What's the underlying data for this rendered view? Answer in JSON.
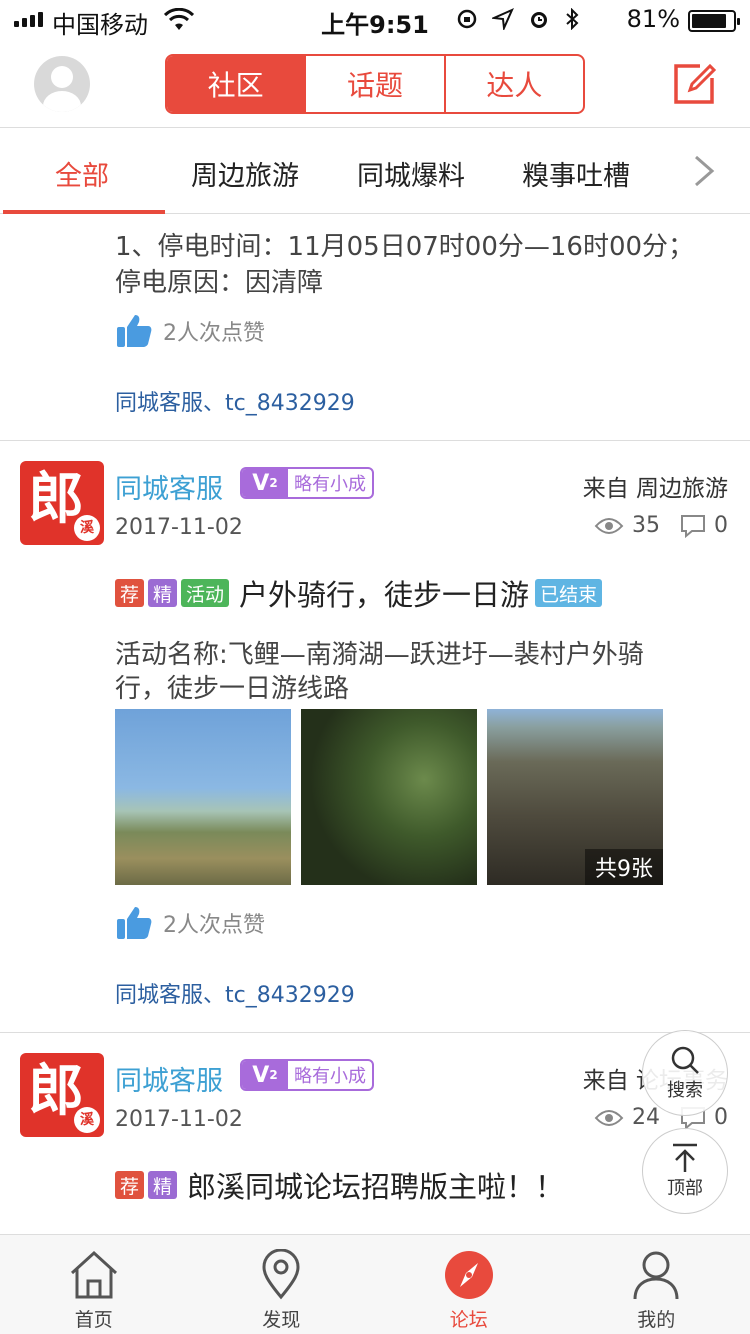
{
  "status_bar": {
    "carrier": "中国移动",
    "time": "上午9:51",
    "battery": "81%"
  },
  "header": {
    "segments": [
      "社区",
      "话题",
      "达人"
    ]
  },
  "categories": [
    "全部",
    "周边旅游",
    "同城爆料",
    "糗事吐槽"
  ],
  "partial_post": {
    "text_line1": "1、停电时间：11月05日07时00分—16时00分；",
    "text_line2": "停电原因：因清障",
    "likes": "2人次点赞",
    "likers": "同城客服、tc_8432929"
  },
  "posts": [
    {
      "avatar_char": "郎",
      "avatar_small": "溪",
      "author": "同城客服",
      "level_badge": "V",
      "level_num": "2",
      "level_title": "略有小成",
      "from": "来自 周边旅游",
      "date": "2017-11-02",
      "views": "35",
      "comments": "0",
      "tags": [
        "荐",
        "精",
        "活动"
      ],
      "title": "户外骑行，徒步一日游",
      "status_tag": "已结束",
      "body_line1": "活动名称:飞鲤—南漪湖—跃进圩—裴村户外骑",
      "body_line2": "行，徒步一日游线路",
      "image_count": "共9张",
      "likes": "2人次点赞",
      "likers": "同城客服、tc_8432929"
    },
    {
      "avatar_char": "郎",
      "avatar_small": "溪",
      "author": "同城客服",
      "level_badge": "V",
      "level_num": "2",
      "level_title": "略有小成",
      "from": "来自 论坛事务",
      "date": "2017-11-02",
      "views": "24",
      "comments": "0",
      "tags": [
        "荐",
        "精"
      ],
      "title": "郎溪同城论坛招聘版主啦！！"
    }
  ],
  "floating": {
    "search": "搜索",
    "top": "顶部"
  },
  "tabbar": [
    "首页",
    "发现",
    "论坛",
    "我的"
  ],
  "colors": {
    "accent": "#e84a3d",
    "author_blue": "#3da0d3",
    "link_blue": "#2c5fa0",
    "level_purple": "#a86bdb"
  }
}
